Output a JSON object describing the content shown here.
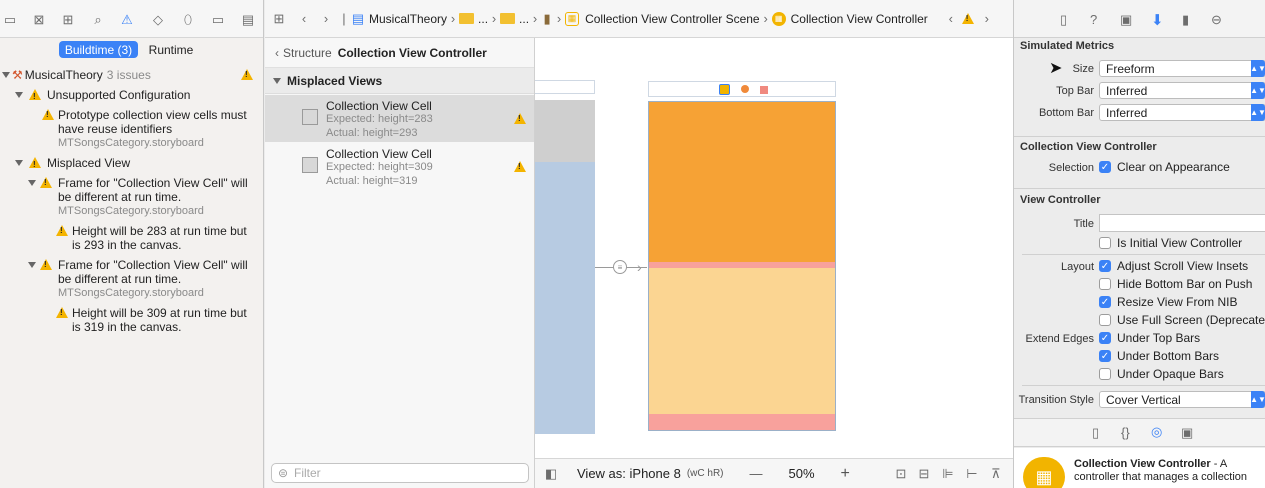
{
  "navigator": {
    "tabs": {
      "buildtime": "Buildtime (3)",
      "runtime": "Runtime"
    },
    "project": {
      "name": "MusicalTheory",
      "count": "3 issues"
    },
    "groups": [
      {
        "title": "Unsupported Configuration",
        "issues": [
          {
            "line1": "Prototype collection view cells must",
            "line2": "have reuse identifiers",
            "file": "MTSongsCategory.storyboard"
          }
        ]
      },
      {
        "title": "Misplaced View",
        "issues": [
          {
            "line1": "Frame for \"Collection View Cell\" will",
            "line2": "be different at run time.",
            "file": "MTSongsCategory.storyboard",
            "detail1": "Height will be 283 at run time but",
            "detail2": "is 293 in the canvas."
          },
          {
            "line1": "Frame for \"Collection View Cell\" will",
            "line2": "be different at run time.",
            "file": "MTSongsCategory.storyboard",
            "detail1": "Height will be 309 at run time but",
            "detail2": "is 319 in the canvas."
          }
        ]
      }
    ]
  },
  "jumpbar": {
    "items": [
      "MusicalTheory",
      "...",
      "...",
      "Collection View Controller Scene",
      "Collection View Controller"
    ]
  },
  "structure": {
    "back_label": "Structure",
    "title": "Collection View Controller",
    "section": "Misplaced Views",
    "cells": [
      {
        "name": "Collection View Cell",
        "expected": "Expected: height=283",
        "actual": "Actual: height=293"
      },
      {
        "name": "Collection View Cell",
        "expected": "Expected: height=309",
        "actual": "Actual: height=319"
      }
    ],
    "filter_placeholder": "Filter"
  },
  "canvas": {
    "view_as": "View as: iPhone 8",
    "size_class": "(wC hR)",
    "zoom": "50%",
    "zoom_out": "—",
    "zoom_in": "+"
  },
  "inspector": {
    "simulated_metrics": {
      "title": "Simulated Metrics",
      "size_label": "Size",
      "size_value": "Freeform",
      "top_bar_label": "Top Bar",
      "top_bar_value": "Inferred",
      "bottom_bar_label": "Bottom Bar",
      "bottom_bar_value": "Inferred"
    },
    "collection_vc": {
      "title": "Collection View Controller",
      "selection_label": "Selection",
      "clear_on_appearance": "Clear on Appearance"
    },
    "view_controller": {
      "title": "View Controller",
      "title_label": "Title",
      "title_value": "",
      "is_initial": "Is Initial View Controller",
      "layout_label": "Layout",
      "adjust_scroll": "Adjust Scroll View Insets",
      "hide_bottom": "Hide Bottom Bar on Push",
      "resize_nib": "Resize View From NIB",
      "full_screen": "Use Full Screen (Deprecated)",
      "extend_label": "Extend Edges",
      "under_top": "Under Top Bars",
      "under_bottom": "Under Bottom Bars",
      "under_opaque": "Under Opaque Bars",
      "transition_label": "Transition Style",
      "transition_value": "Cover Vertical"
    },
    "library": {
      "name": "Collection View Controller",
      "desc_a": " - A",
      "desc_b": "controller that manages a collection"
    }
  },
  "colors": {
    "accent": "#3b82f6",
    "warning": "#f4b400",
    "cell_orange": "#f6a235",
    "cell_peach": "#fbd592",
    "cell_pink": "#f8a19c",
    "selected_row": "#dcdcdc"
  }
}
